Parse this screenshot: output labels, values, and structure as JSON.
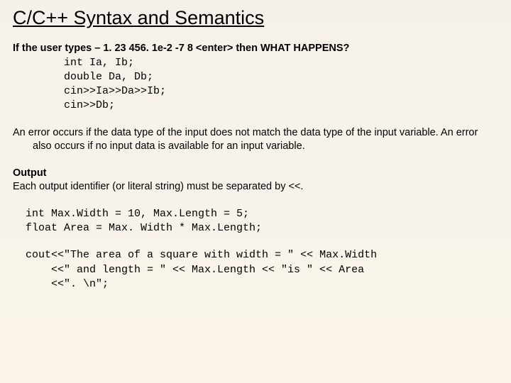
{
  "title": "C/C++ Syntax and Semantics",
  "intro": {
    "prefix": "If the user types  ",
    "typed": "– 1. 23  456. 1e-2  -7  8 <enter>",
    "suffix": "  then WHAT HAPPENS?"
  },
  "code1": {
    "l1": "int Ia, Ib;",
    "l2": "double Da, Db;",
    "l3": "cin>>Ia>>Da>>Ib;",
    "l4": "cin>>Db;"
  },
  "errPara": "An error occurs if the data type of the input does not match the data type of the input variable. An error also occurs if no input data is available for an input variable.",
  "output": {
    "heading": "Output",
    "line": "Each output identifier (or literal string) must be separated by <<."
  },
  "code2": {
    "l1": "int Max.Width = 10, Max.Length = 5;",
    "l2": "float Area = Max. Width * Max.Length;"
  },
  "code3": {
    "l1": "cout<<\"The area of a square with width = \" << Max.Width",
    "l2": "<<\" and length = \" << Max.Length << \"is \" << Area",
    "l3": "<<\". \\n\";"
  }
}
